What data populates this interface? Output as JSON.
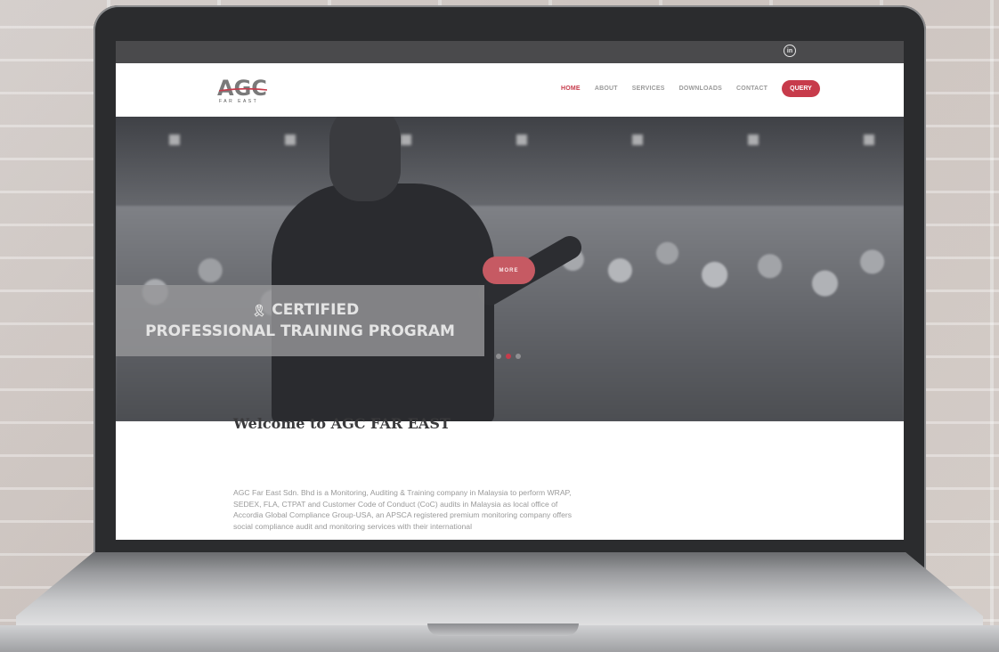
{
  "topbar": {
    "social_icon": "linkedin-icon",
    "social_glyph": "in"
  },
  "header": {
    "logo_text": "AGC",
    "logo_subtext": "FAR EAST",
    "nav": [
      {
        "label": "HOME",
        "active": true
      },
      {
        "label": "ABOUT",
        "active": false
      },
      {
        "label": "SERVICES",
        "active": false
      },
      {
        "label": "DOWNLOADS",
        "active": false
      },
      {
        "label": "CONTACT",
        "active": false
      }
    ],
    "query_label": "QUERY"
  },
  "hero": {
    "more_label": "MORE",
    "banner_line1": "CERTIFIED",
    "banner_line2": "PROFESSIONAL TRAINING PROGRAM",
    "badge_icon": "award-ribbon-icon",
    "badge_glyph": "🎗",
    "slides": 3,
    "active_slide": 2
  },
  "welcome": {
    "title": "Welcome to AGC FAR EAST",
    "text": "AGC Far East Sdn. Bhd is a Monitoring, Auditing & Training company in Malaysia to perform WRAP, SEDEX, FLA, CTPAT and Customer Code of Conduct (CoC) audits in Malaysia as local office of Accordia Global Compliance Group-USA, an APSCA registered premium monitoring company offers social compliance audit and monitoring services with their international"
  },
  "colors": {
    "accent": "#c73b4b",
    "topbar": "#4a4a4c",
    "nav_text": "#9a9a9a"
  }
}
